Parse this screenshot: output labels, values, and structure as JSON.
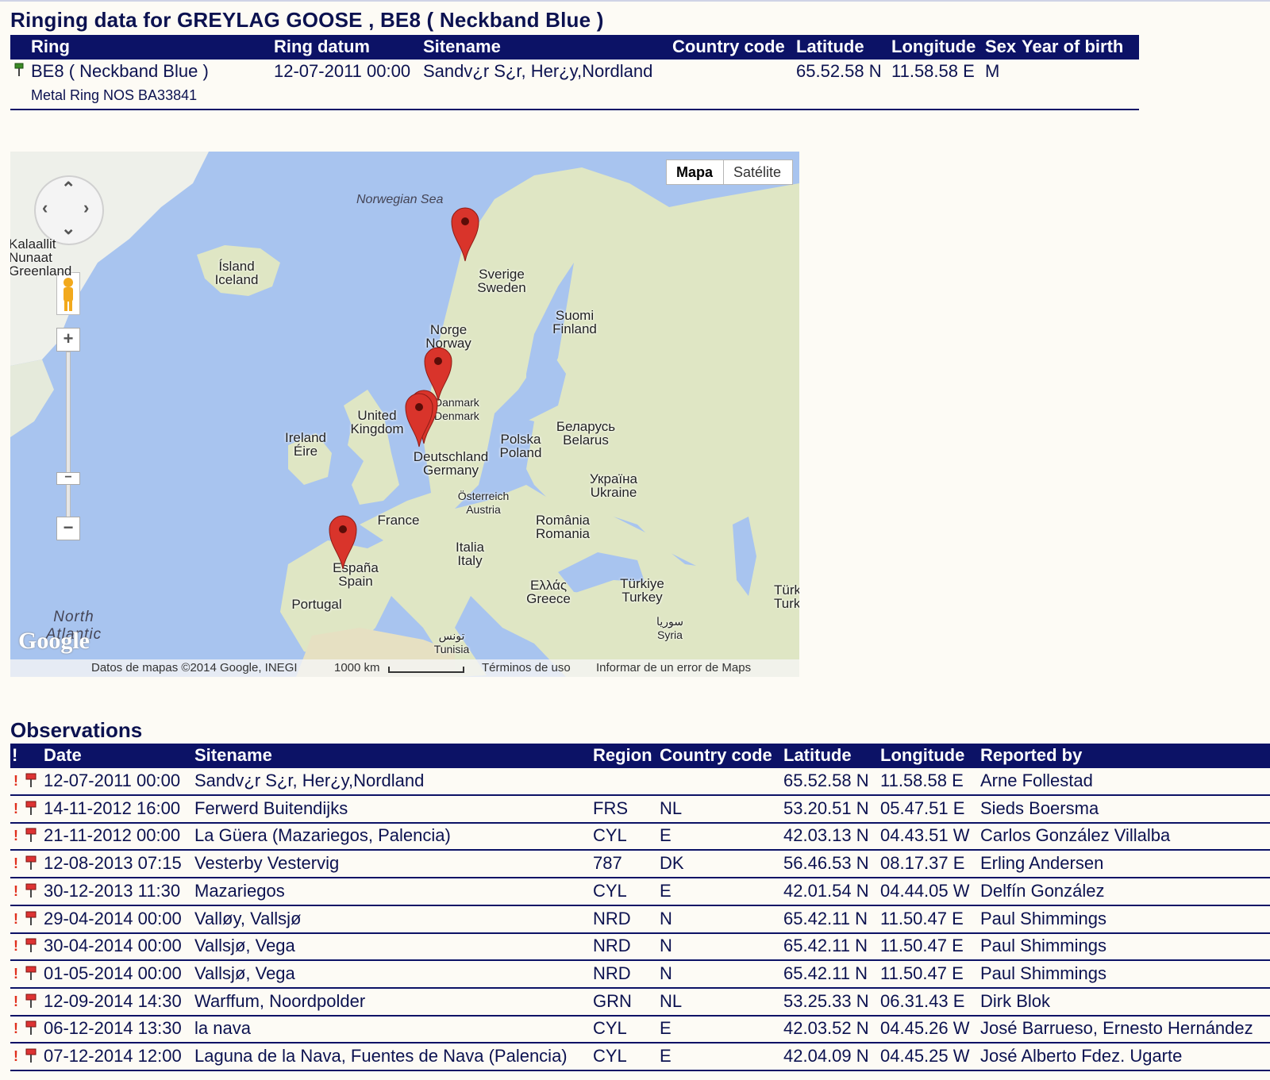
{
  "page_title": "Ringing data for GREYLAG GOOSE , BE8 ( Neckband Blue )",
  "ringing": {
    "headers": {
      "ring": "Ring",
      "ring_datum": "Ring datum",
      "sitename": "Sitename",
      "country_code": "Country code",
      "latitude": "Latitude",
      "longitude": "Longitude",
      "sex": "Sex",
      "year_of_birth": "Year of birth"
    },
    "row": {
      "ring": "BE8 ( Neckband Blue )",
      "metal_ring": "Metal Ring NOS BA33841",
      "ring_datum": "12-07-2011 00:00",
      "sitename": "Sandv¿r S¿r, Her¿y,Nordland",
      "country_code": "",
      "latitude": "65.52.58 N",
      "longitude": "11.58.58 E",
      "sex": "M",
      "year_of_birth": ""
    }
  },
  "map": {
    "type_buttons": [
      "Mapa",
      "Satélite"
    ],
    "active_type": "Mapa",
    "labels": {
      "norwegian_sea": "Norwegian Sea",
      "north_atlantic": "North Atlantic",
      "kalaallit": "Kalaallit Nunaat Greenland",
      "iceland": "Ísland Iceland",
      "sweden": "Sverige Sweden",
      "finland": "Suomi Finland",
      "norway": "Norge Norway",
      "denmark": "Danmark Denmark",
      "uk": "United Kingdom",
      "ireland": "Ireland Éire",
      "belarus": "Беларусь Belarus",
      "poland": "Polska Poland",
      "germany": "Deutschland Germany",
      "ukraine": "Україна Ukraine",
      "austria": "Österreich Austria",
      "france": "France",
      "romania": "România Romania",
      "italy": "Italia Italy",
      "spain": "España Spain",
      "portugal": "Portugal",
      "greece": "Ελλάς Greece",
      "turkey": "Türkiye Turkey",
      "turkey2": "Türk Turk",
      "syria": "سوريا Syria",
      "tunisia": "تونس Tunisia"
    },
    "footer": {
      "attribution": "Datos de mapas ©2014 Google, INEGI",
      "scale": "1000 km",
      "terms": "Términos de uso",
      "report": "Informar de un error de Maps",
      "google": "Google"
    },
    "controls": {
      "zoom_in": "+",
      "zoom_out": "−"
    }
  },
  "observations": {
    "title": "Observations",
    "headers": {
      "flag": "!",
      "date": "Date",
      "sitename": "Sitename",
      "region": "Region",
      "country_code": "Country code",
      "latitude": "Latitude",
      "longitude": "Longitude",
      "reported_by": "Reported by"
    },
    "rows": [
      {
        "date": "12-07-2011 00:00",
        "sitename": "Sandv¿r S¿r, Her¿y,Nordland",
        "region": "",
        "country": "",
        "lat": "65.52.58 N",
        "lon": "11.58.58 E",
        "reported_by": "Arne Follestad"
      },
      {
        "date": "14-11-2012 16:00",
        "sitename": "Ferwerd Buitendijks",
        "region": "FRS",
        "country": "NL",
        "lat": "53.20.51 N",
        "lon": "05.47.51 E",
        "reported_by": "Sieds Boersma"
      },
      {
        "date": "21-11-2012 00:00",
        "sitename": "La Güera (Mazariegos, Palencia)",
        "region": "CYL",
        "country": "E",
        "lat": "42.03.13 N",
        "lon": "04.43.51 W",
        "reported_by": "Carlos González Villalba"
      },
      {
        "date": "12-08-2013 07:15",
        "sitename": "Vesterby Vestervig",
        "region": "787",
        "country": "DK",
        "lat": "56.46.53 N",
        "lon": "08.17.37 E",
        "reported_by": "Erling Andersen"
      },
      {
        "date": "30-12-2013 11:30",
        "sitename": "Mazariegos",
        "region": "CYL",
        "country": "E",
        "lat": "42.01.54 N",
        "lon": "04.44.05 W",
        "reported_by": "Delfín González"
      },
      {
        "date": "29-04-2014 00:00",
        "sitename": "Valløy, Vallsjø",
        "region": "NRD",
        "country": "N",
        "lat": "65.42.11 N",
        "lon": "11.50.47 E",
        "reported_by": "Paul Shimmings"
      },
      {
        "date": "30-04-2014 00:00",
        "sitename": "Vallsjø, Vega",
        "region": "NRD",
        "country": "N",
        "lat": "65.42.11 N",
        "lon": "11.50.47 E",
        "reported_by": "Paul Shimmings"
      },
      {
        "date": "01-05-2014 00:00",
        "sitename": "Vallsjø, Vega",
        "region": "NRD",
        "country": "N",
        "lat": "65.42.11 N",
        "lon": "11.50.47 E",
        "reported_by": "Paul Shimmings"
      },
      {
        "date": "12-09-2014 14:30",
        "sitename": "Warffum, Noordpolder",
        "region": "GRN",
        "country": "NL",
        "lat": "53.25.33 N",
        "lon": "06.31.43 E",
        "reported_by": "Dirk Blok"
      },
      {
        "date": "06-12-2014 13:30",
        "sitename": "la nava",
        "region": "CYL",
        "country": "E",
        "lat": "42.03.52 N",
        "lon": "04.45.26 W",
        "reported_by": "José Barrueso, Ernesto Hernández"
      },
      {
        "date": "07-12-2014 12:00",
        "sitename": "Laguna de la Nava, Fuentes de Nava (Palencia)",
        "region": "CYL",
        "country": "E",
        "lat": "42.04.09 N",
        "lon": "04.45.25 W",
        "reported_by": "José Alberto Fdez. Ugarte"
      }
    ]
  },
  "colors": {
    "header_bg": "#0c1266",
    "text": "#0c1250",
    "marker": "#d9342b",
    "water": "#a8c4ef",
    "land": "#dfe6c4"
  }
}
